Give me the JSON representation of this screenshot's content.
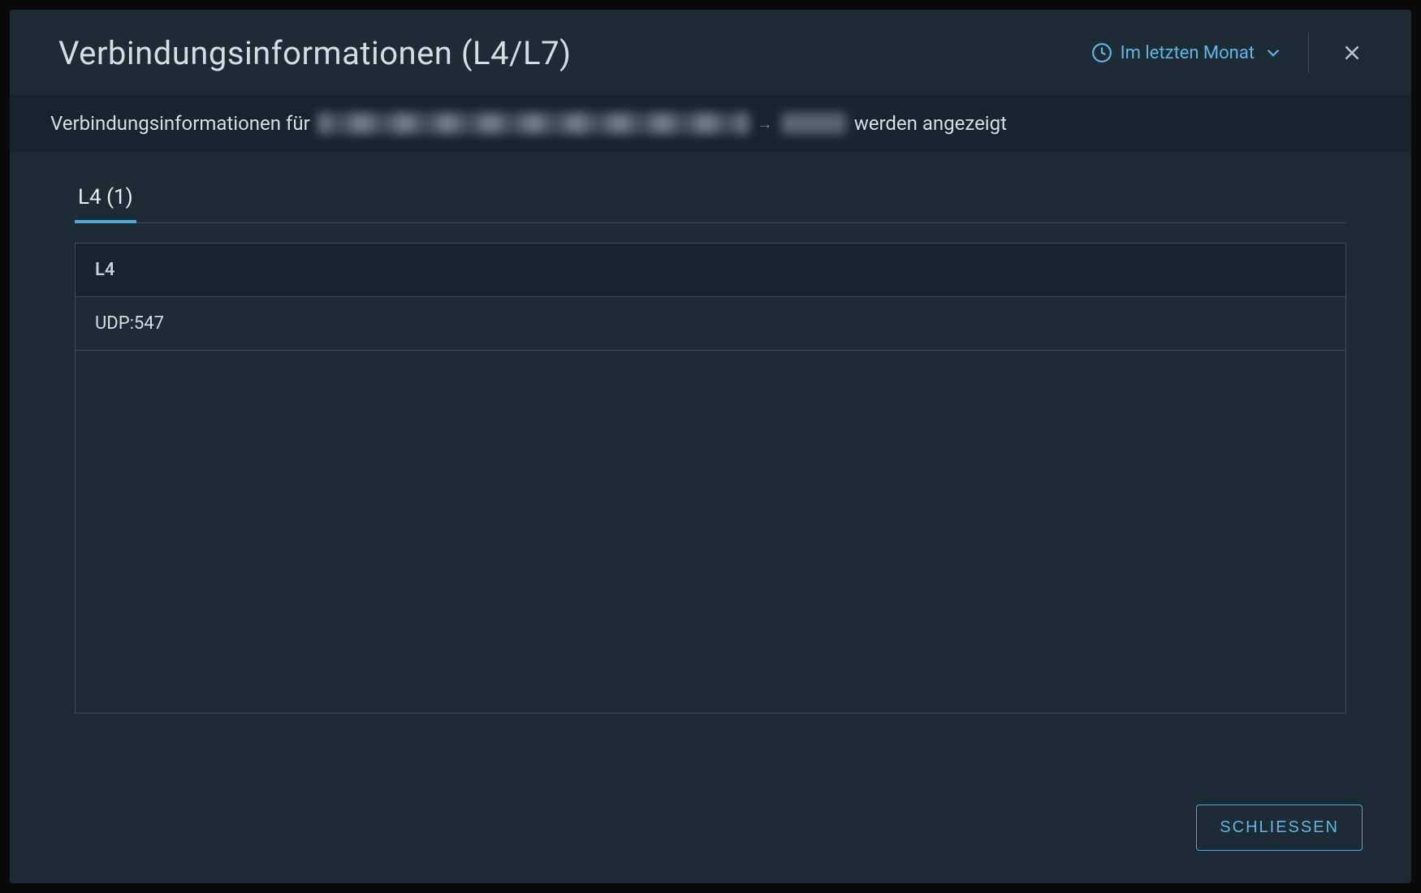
{
  "modal": {
    "title": "Verbindungsinformationen (L4/L7)",
    "timeFilter": "Im letzten Monat",
    "infoBar": {
      "prefix": "Verbindungsinformationen für",
      "suffix": "werden angezeigt"
    },
    "tabs": [
      {
        "label": "L4 (1)",
        "active": true
      }
    ],
    "table": {
      "header": "L4",
      "rows": [
        "UDP:547"
      ]
    },
    "closeButton": "SCHLIESSEN"
  }
}
